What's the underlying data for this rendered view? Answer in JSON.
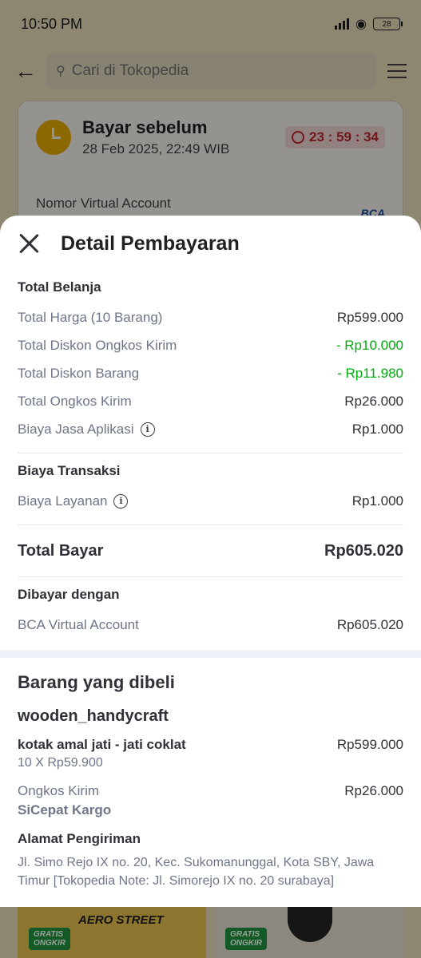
{
  "status_bar": {
    "time": "10:50 PM",
    "battery": "28"
  },
  "background": {
    "search_placeholder": "Cari di Tokopedia",
    "pay_before_title": "Bayar sebelum",
    "pay_before_date": "28 Feb 2025, 22:49 WIB",
    "countdown": "23 : 59 : 34",
    "va_label": "Nomor Virtual Account",
    "bank_logo_text": "BCA"
  },
  "sheet": {
    "title": "Detail Pembayaran",
    "total_belanja": {
      "title": "Total Belanja",
      "rows": [
        {
          "label": "Total Harga (10 Barang)",
          "value": "Rp599.000"
        },
        {
          "label": "Total Diskon Ongkos Kirim",
          "value": "- Rp10.000"
        },
        {
          "label": "Total Diskon Barang",
          "value": "- Rp11.980"
        },
        {
          "label": "Total Ongkos Kirim",
          "value": "Rp26.000"
        },
        {
          "label": "Biaya Jasa Aplikasi",
          "value": "Rp1.000"
        }
      ]
    },
    "biaya_transaksi": {
      "title": "Biaya Transaksi",
      "rows": [
        {
          "label": "Biaya Layanan",
          "value": "Rp1.000"
        }
      ]
    },
    "total_bayar": {
      "label": "Total Bayar",
      "value": "Rp605.020"
    },
    "dibayar_dengan": {
      "title": "Dibayar dengan",
      "method": "BCA Virtual Account",
      "amount": "Rp605.020"
    },
    "colors": {
      "discount": "#03ac0e",
      "text": "#2e3137",
      "muted": "#6d7588"
    }
  },
  "items": {
    "title": "Barang yang dibeli",
    "shop": "wooden_handycraft",
    "product_name": "kotak amal jati - jati coklat",
    "product_price": "Rp599.000",
    "product_qty": "10 X Rp59.900",
    "shipping_label": "Ongkos Kirim",
    "shipping_price": "Rp26.000",
    "courier": "SiCepat Kargo",
    "address_title": "Alamat Pengiriman",
    "address": "Jl. Simo Rejo IX no. 20, Kec. Sukomanunggal, Kota SBY, Jawa Timur [Tokopedia Note: Jl. Simorejo IX no. 20 surabaya]"
  },
  "peek": {
    "badge_line1": "GRATIS",
    "badge_line2": "ONGKIR",
    "brand_text": "AERO STREET"
  }
}
